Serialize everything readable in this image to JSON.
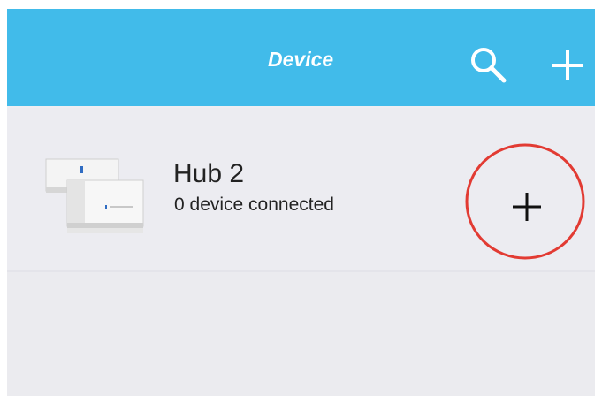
{
  "header": {
    "title": "Device",
    "background": "#41bbea",
    "icons": [
      "search-icon",
      "plus-icon"
    ]
  },
  "device": {
    "name": "Hub 2",
    "status": "0 device connected",
    "action_icon": "plus-icon"
  },
  "annotation": {
    "color": "#e23b33"
  }
}
